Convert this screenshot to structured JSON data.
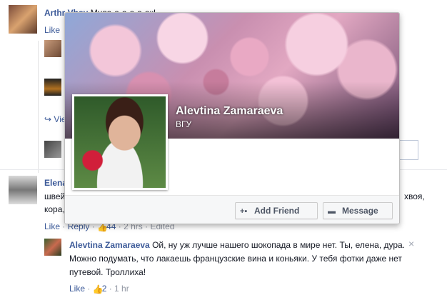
{
  "feed": {
    "comment1": {
      "author": "Arthr Vhsv",
      "text": "Мула-а-а-а-а-ак!",
      "like": "Like"
    },
    "view_more": "Vie",
    "comment2": {
      "author": "Elena",
      "text_line1": "швей",
      "text_right": "хвоя,",
      "text_line2": "кора,",
      "like": "Like",
      "reply": "Reply",
      "likes": "44",
      "time": "2 hrs",
      "edited": "Edited"
    },
    "reply": {
      "author": "Alevtina Zamaraeva",
      "text": "Ой, ну уж лучше нашего шокопада в мире нет. Ты, елена, дура. Можно подумать, что лакаешь французские вина и коньяки. У тебя фотки даже нет путевой. Троллиха!",
      "like": "Like",
      "likes": "2",
      "time": "1 hr",
      "close": "×"
    }
  },
  "hovercard": {
    "name": "Alevtina Zamaraeva",
    "subtitle": "ВГУ",
    "add_friend": "Add Friend",
    "message": "Message"
  }
}
